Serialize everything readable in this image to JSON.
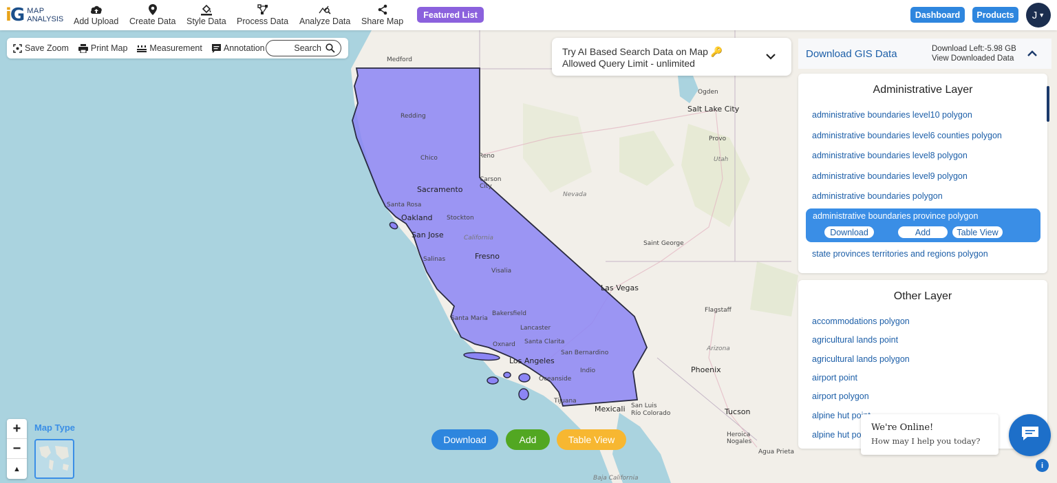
{
  "app": {
    "logo_line1": "MAP",
    "logo_line2": "ANALYSIS",
    "logo_mark": "iG"
  },
  "toolbar": [
    {
      "label": "Add Upload",
      "icon": "cloud-upload-icon"
    },
    {
      "label": "Create Data",
      "icon": "map-pin-icon"
    },
    {
      "label": "Style Data",
      "icon": "paint-bucket-icon"
    },
    {
      "label": "Process Data",
      "icon": "process-nodes-icon"
    },
    {
      "label": "Analyze Data",
      "icon": "analyze-chart-icon"
    },
    {
      "label": "Share Map",
      "icon": "share-icon"
    }
  ],
  "featured_label": "Featured List",
  "header_buttons": {
    "dashboard": "Dashboard",
    "products": "Products"
  },
  "user": {
    "initial": "J"
  },
  "subtoolbar": {
    "save_zoom": "Save Zoom",
    "print_map": "Print Map",
    "measurement": "Measurement",
    "annotation": "Annotation",
    "search": "Search"
  },
  "ai_search": {
    "line1": "Try AI Based Search Data on Map",
    "line2": "Allowed Query Limit - unlimited"
  },
  "panel": {
    "title": "Download GIS Data",
    "download_left": "Download Left:-5.98 GB",
    "view_downloaded": "View Downloaded Data",
    "admin_title": "Administrative Layer",
    "admin_layers": [
      "administrative boundaries level10 polygon",
      "administrative boundaries level6 counties polygon",
      "administrative boundaries level8 polygon",
      "administrative boundaries level9 polygon",
      "administrative boundaries polygon"
    ],
    "selected_layer": "administrative boundaries province polygon",
    "selected_actions": {
      "download": "Download",
      "add": "Add",
      "table_view": "Table View"
    },
    "admin_last": "state provinces territories and regions polygon",
    "other_title": "Other Layer",
    "other_layers": [
      "accommodations polygon",
      "agricultural lands point",
      "agricultural lands polygon",
      "airport point",
      "airport polygon",
      "alpine hut point",
      "alpine hut polygon"
    ]
  },
  "bottom_actions": {
    "download": "Download",
    "add": "Add",
    "table_view": "Table View"
  },
  "map_type_label": "Map Type",
  "chat": {
    "line1": "We're Online!",
    "line2": "How may I help you today?"
  },
  "colors": {
    "accent": "#2e86de",
    "featured": "#8b61dd",
    "add_green": "#52a722",
    "table_yellow": "#f7b731",
    "polygon_fill": "#8c85f5",
    "water": "#aad3df"
  },
  "map_labels": {
    "medford": "Medford",
    "redding": "Redding",
    "chico": "Chico",
    "reno": "Reno",
    "carson_city": "Carson City",
    "sacramento": "Sacramento",
    "santa_rosa": "Santa Rosa",
    "oakland": "Oakland",
    "stockton": "Stockton",
    "san_jose": "San Jose",
    "california": "California",
    "salinas": "Salinas",
    "fresno": "Fresno",
    "visalia": "Visalia",
    "santa_maria": "Santa Maria",
    "bakersfield": "Bakersfield",
    "lancaster": "Lancaster",
    "oxnard": "Oxnard",
    "santa_clarita": "Santa Clarita",
    "los_angeles": "Los Angeles",
    "san_bernardino": "San Bernardino",
    "indio": "Indio",
    "oceanside": "Oceanside",
    "tijuana": "Tijuana",
    "mexicali": "Mexicali",
    "san_luis": "San Luis",
    "rio_colorado": "Río Colorado",
    "ogden": "Ogden",
    "salt_lake_city": "Salt Lake City",
    "provo": "Provo",
    "utah": "Utah",
    "nevada": "Nevada",
    "saint_george": "Saint George",
    "las_vegas": "Las Vegas",
    "flagstaff": "Flagstaff",
    "arizona": "Arizona",
    "phoenix": "Phoenix",
    "tucson": "Tucson",
    "heroica_nogales": "Heroica Nogales",
    "agua_prieta": "Agua Prieta",
    "baja_california": "Baja California"
  }
}
